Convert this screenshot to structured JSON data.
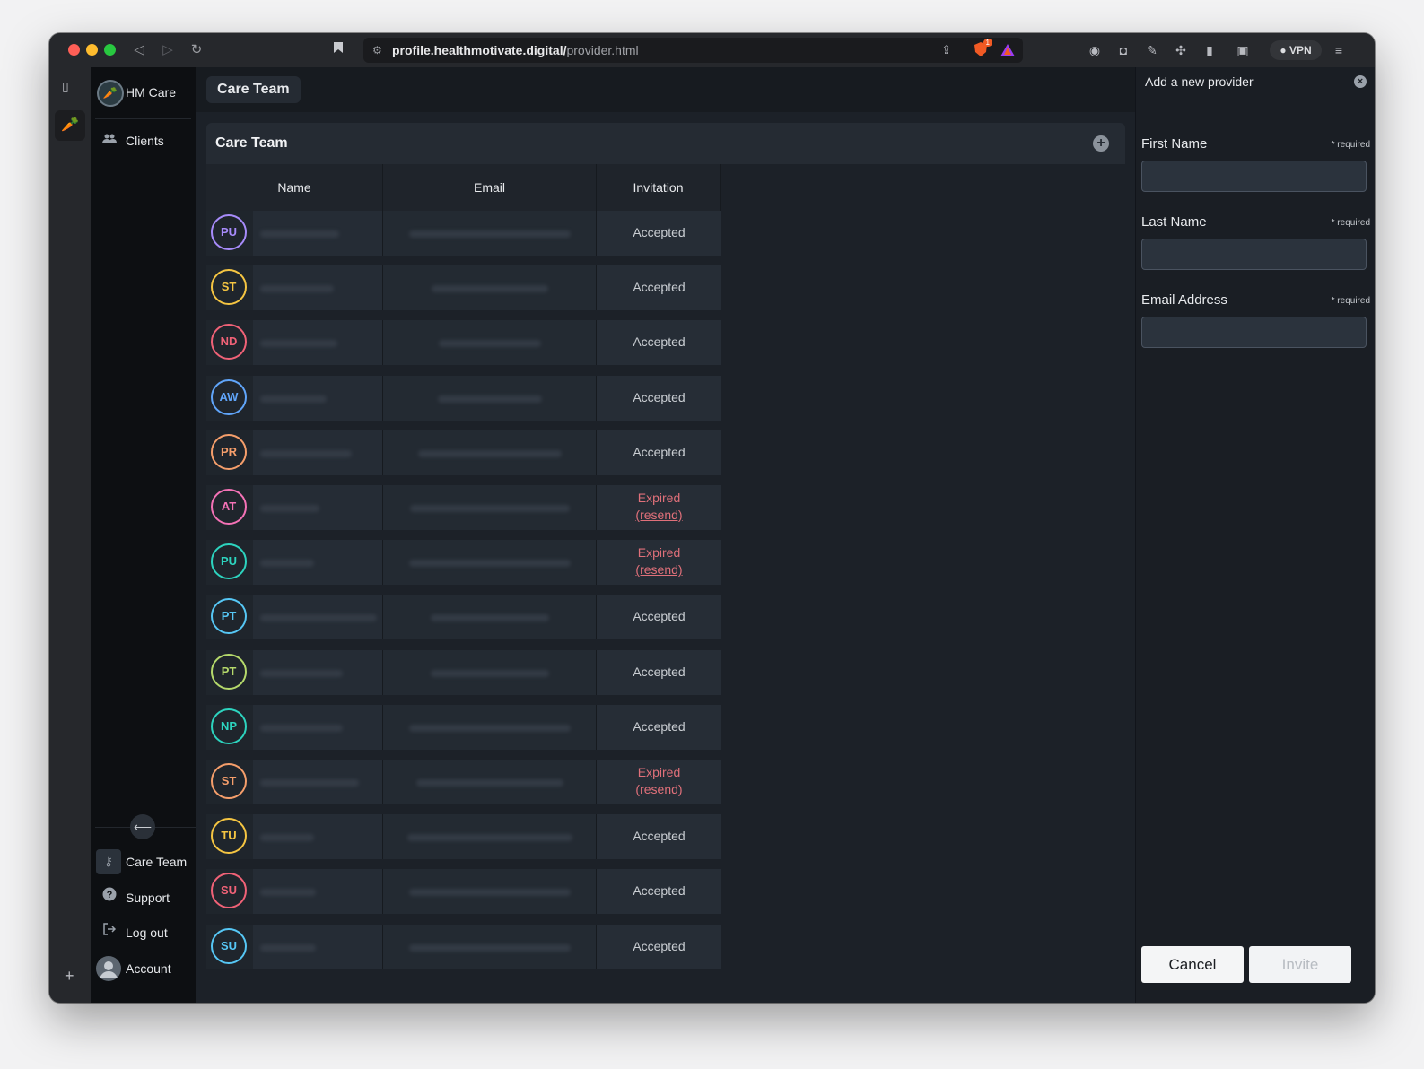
{
  "browser": {
    "url_host": "profile.healthmotivate.digital/",
    "url_path": "provider.html",
    "vpn_label": "VPN",
    "shield_badge": "1"
  },
  "sidebar": {
    "brand": "HM Care",
    "items": [
      {
        "label": "Clients",
        "icon": "people-icon"
      }
    ],
    "bottom_items": [
      {
        "label": "Care Team",
        "icon": "key-icon"
      },
      {
        "label": "Support",
        "icon": "help-icon"
      },
      {
        "label": "Log out",
        "icon": "logout-icon"
      },
      {
        "label": "Account",
        "icon": "avatar-icon"
      }
    ],
    "collapse_glyph": "⟵"
  },
  "main": {
    "breadcrumb": "Care Team",
    "card_title": "Care Team",
    "columns": [
      "Name",
      "Email",
      "Invitation"
    ],
    "rows": [
      {
        "initials": "PU",
        "color": "#a78bfa",
        "invitation": "Accepted"
      },
      {
        "initials": "ST",
        "color": "#f5c542",
        "invitation": "Accepted"
      },
      {
        "initials": "ND",
        "color": "#f06277",
        "invitation": "Accepted"
      },
      {
        "initials": "AW",
        "color": "#60a5fa",
        "invitation": "Accepted"
      },
      {
        "initials": "PR",
        "color": "#f59e6b",
        "invitation": "Accepted"
      },
      {
        "initials": "AT",
        "color": "#f472b6",
        "invitation": "Expired",
        "resend": "(resend)"
      },
      {
        "initials": "PU",
        "color": "#2dd4bf",
        "invitation": "Expired",
        "resend": "(resend)"
      },
      {
        "initials": "PT",
        "color": "#56c7f5",
        "invitation": "Accepted"
      },
      {
        "initials": "PT",
        "color": "#b5d96b",
        "invitation": "Accepted"
      },
      {
        "initials": "NP",
        "color": "#2dd4bf",
        "invitation": "Accepted"
      },
      {
        "initials": "ST",
        "color": "#f59e6b",
        "invitation": "Expired",
        "resend": "(resend)"
      },
      {
        "initials": "TU",
        "color": "#f5c542",
        "invitation": "Accepted"
      },
      {
        "initials": "SU",
        "color": "#f06277",
        "invitation": "Accepted"
      },
      {
        "initials": "SU",
        "color": "#56c7f5",
        "invitation": "Accepted"
      }
    ]
  },
  "drawer": {
    "title": "Add a new provider",
    "fields": [
      {
        "label": "First Name",
        "required": "* required",
        "value": ""
      },
      {
        "label": "Last Name",
        "required": "* required",
        "value": ""
      },
      {
        "label": "Email Address",
        "required": "* required",
        "value": ""
      }
    ],
    "cancel_label": "Cancel",
    "invite_label": "Invite"
  }
}
